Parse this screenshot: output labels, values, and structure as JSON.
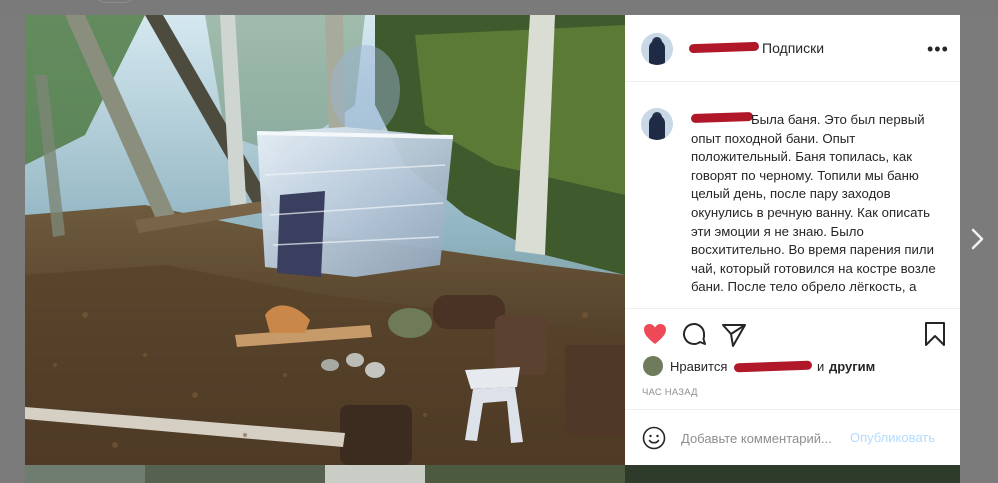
{
  "post": {
    "header": {
      "status_label": "Подписки",
      "more_icon": "more-horizontal-icon"
    },
    "caption": {
      "text": "Была баня. Это был первый опыт походной бани. Опыт положительный. Баня топилась, как говорят по черному. Топили мы баню целый день, после пару заходов окунулись в речную ванну. Как описать эти эмоции я не знаю. Было восхитительно. Во время парения пили чай, который готовился на костре возле бани. После тело обрело лёгкость, а"
    },
    "actions": {
      "like_icon": "heart-filled-icon",
      "comment_icon": "comment-icon",
      "share_icon": "paper-plane-icon",
      "save_icon": "bookmark-icon",
      "like_color": "#ed4956"
    },
    "likes": {
      "prefix": "Нравится",
      "conjunction": "и",
      "others": "другим"
    },
    "time": "ЧАС НАЗАД",
    "comment": {
      "placeholder": "Добавьте комментарий...",
      "publish_label": "Опубликовать",
      "emoji_icon": "smiley-icon",
      "publish_color": "#b3dbff"
    }
  },
  "navigation": {
    "next_icon": "chevron-right-icon"
  }
}
